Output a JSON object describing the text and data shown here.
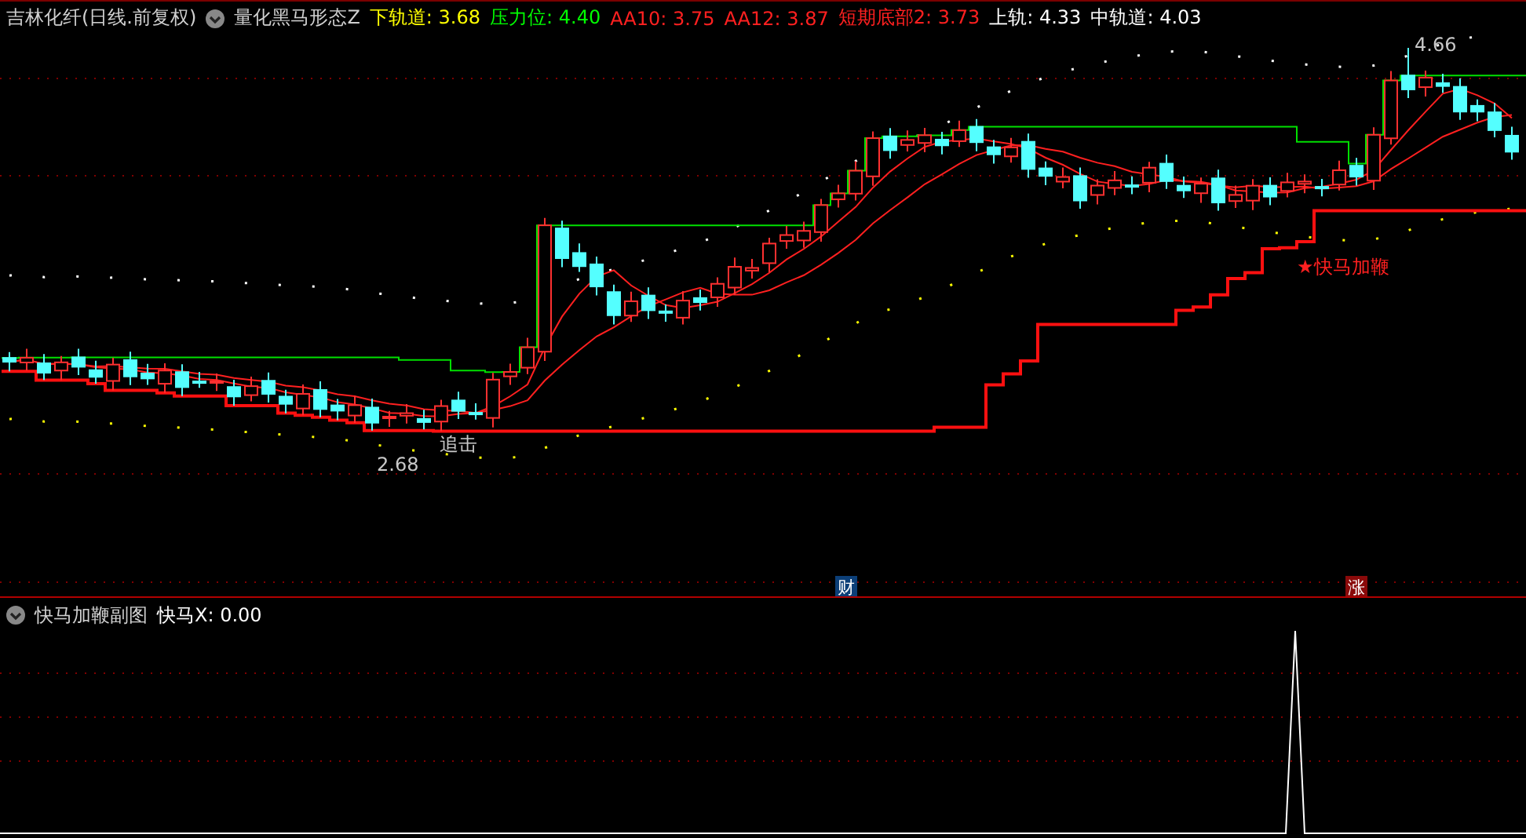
{
  "header": {
    "title": "吉林化纤(日线.前复权)",
    "indicator": "量化黑马形态Z",
    "legend": [
      {
        "label": "下轨道:",
        "value": "3.68",
        "color": "#ffff00"
      },
      {
        "label": "压力位:",
        "value": "4.40",
        "color": "#00ff00"
      },
      {
        "label": "AA10:",
        "value": "3.75",
        "color": "#ff2020"
      },
      {
        "label": "AA12:",
        "value": "3.87",
        "color": "#ff2020"
      },
      {
        "label": "短期底部2:",
        "value": "3.73",
        "color": "#ff2020"
      },
      {
        "label": "上轨:",
        "value": "4.33",
        "color": "#ffffff"
      },
      {
        "label": "中轨道:",
        "value": "4.03",
        "color": "#ffffff"
      }
    ]
  },
  "chart": {
    "annotations": [
      {
        "kind": "low",
        "text": "2.68"
      },
      {
        "kind": "high",
        "text": "4.66"
      },
      {
        "kind": "chase",
        "text": "追击"
      },
      {
        "kind": "star",
        "text": "★快马加鞭"
      }
    ],
    "markers": [
      {
        "text": "财",
        "color": "#0c3f78"
      },
      {
        "text": "涨",
        "color": "#8a0a0a"
      }
    ]
  },
  "sub": {
    "title": "快马加鞭副图",
    "legend": [
      {
        "label": "快马X:",
        "value": "0.00",
        "color": "#ffffff"
      }
    ]
  }
}
